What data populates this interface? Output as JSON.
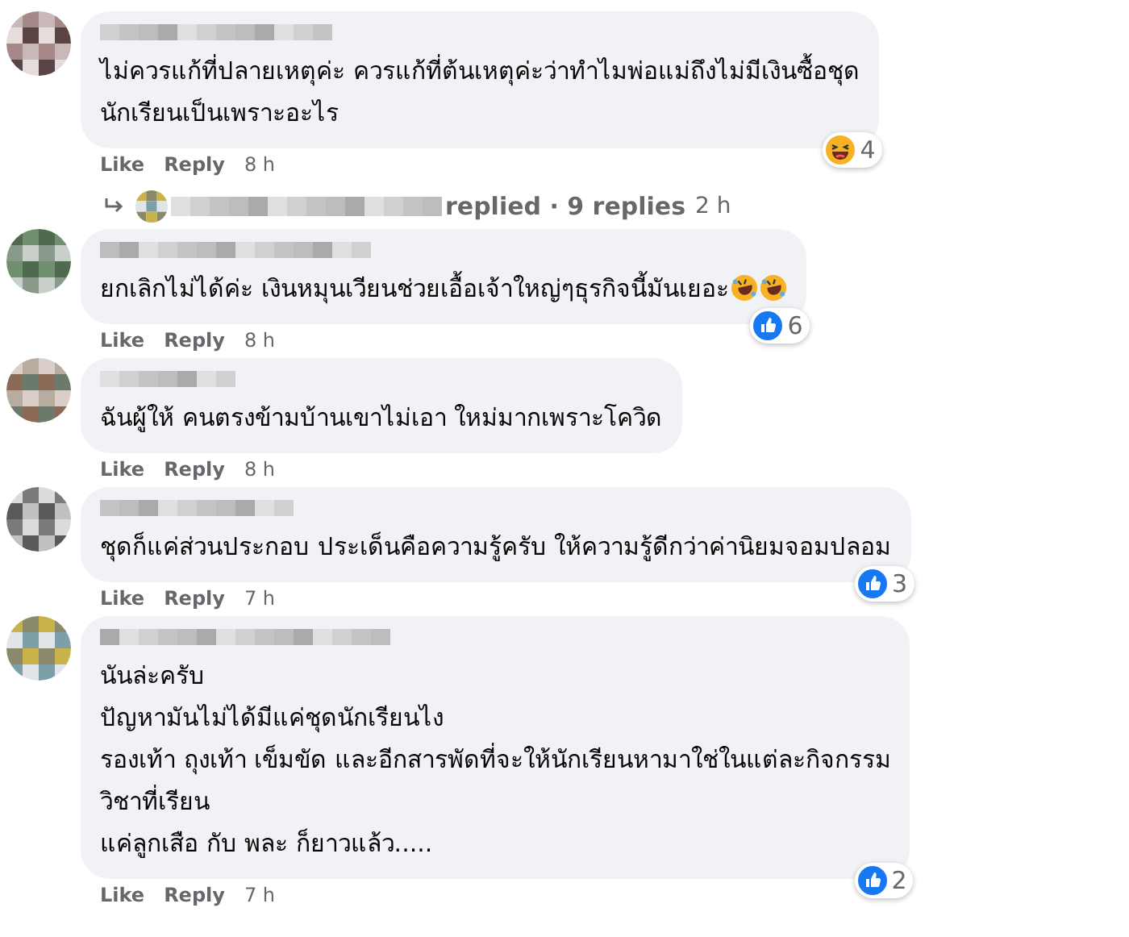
{
  "comments": [
    {
      "lines": [
        "ไม่ควรแก้ที่ปลายเหตุค่ะ ควรแก้ที่ต้นเหตุค่ะว่าทำไมพ่อแม่ถึงไม่มีเงินซื้อชุด",
        "นักเรียนเป็นเพราะอะไร"
      ],
      "reaction": {
        "kind": "laugh",
        "count": "4"
      },
      "like": "Like",
      "reply": "Reply",
      "time": "8 h",
      "replies": {
        "label": "replied · 9 replies",
        "time": "2 h"
      }
    },
    {
      "lines": [
        "ยกเลิกไม่ได้ค่ะ เงินหมุนเวียนช่วยเอื้อเจ้าใหญ่ๆธุรกิจนี้มันเยอะ"
      ],
      "emojis": [
        {
          "kind": "rofl"
        },
        {
          "kind": "rofl"
        }
      ],
      "reaction": {
        "kind": "like",
        "count": "6"
      },
      "like": "Like",
      "reply": "Reply",
      "time": "8 h"
    },
    {
      "lines": [
        "ฉันผู้ให้ คนตรงข้ามบ้านเขาไม่เอา ใหม่มากเพราะโควิด"
      ],
      "like": "Like",
      "reply": "Reply",
      "time": "8 h"
    },
    {
      "lines": [
        "ชุดก็แค่ส่วนประกอบ ประเด็นคือความรู้ครับ ให้ความรู้ดีกว่าค่านิยมจอมปลอม"
      ],
      "reaction": {
        "kind": "like",
        "count": "3"
      },
      "like": "Like",
      "reply": "Reply",
      "time": "7 h"
    },
    {
      "lines": [
        "นันล่ะครับ",
        "ปัญหามันไม่ได้มีแค่ชุดนักเรียนไง",
        "รองเท้า ถุงเท้า เข็มขัด และอีกสารพัดที่จะให้นักเรียนหามาใช่ในแต่ละกิจกรรม",
        "วิชาที่เรียน",
        "แค่ลูกเสือ กับ พละ ก็ยาวแล้ว....."
      ],
      "reaction": {
        "kind": "like",
        "count": "2"
      },
      "like": "Like",
      "reply": "Reply",
      "time": "7 h"
    }
  ]
}
